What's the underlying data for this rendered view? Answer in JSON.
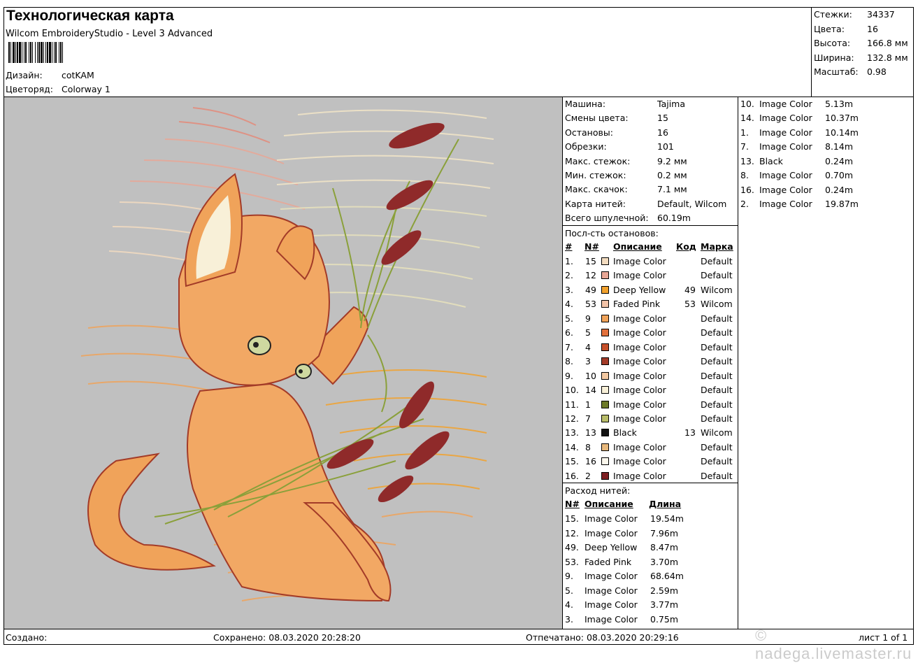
{
  "header": {
    "title": "Технологическая карта",
    "software": "Wilcom EmbroideryStudio - Level 3 Advanced",
    "design_label": "Дизайн:",
    "design_value": "cotKAM",
    "colorway_label": "Цветоряд:",
    "colorway_value": "Colorway 1"
  },
  "summary": [
    {
      "label": "Стежки:",
      "value": "34337"
    },
    {
      "label": "Цвета:",
      "value": "16"
    },
    {
      "label": "Высота:",
      "value": "166.8 мм"
    },
    {
      "label": "Ширина:",
      "value": "132.8 мм"
    },
    {
      "label": "Масштаб:",
      "value": "0.98"
    }
  ],
  "machine": [
    {
      "label": "Машина:",
      "value": "Tajima"
    },
    {
      "label": "Смены цвета:",
      "value": "15"
    },
    {
      "label": "Остановы:",
      "value": "16"
    },
    {
      "label": "Обрезки:",
      "value": "101"
    },
    {
      "label": "Макс. стежок:",
      "value": "9.2 мм"
    },
    {
      "label": "Мин. стежок:",
      "value": "0.2 мм"
    },
    {
      "label": "Макс. скачок:",
      "value": "7.1 мм"
    },
    {
      "label": "Карта нитей:",
      "value": "Default, Wilcom"
    },
    {
      "label": "Всего шпулечной:",
      "value": "60.19m"
    }
  ],
  "stops": {
    "title": "Посл-сть остановов:",
    "headers": [
      "#",
      "N#",
      "Описание",
      "Код",
      "Марка"
    ],
    "rows": [
      {
        "idx": "1.",
        "n": "15",
        "color": "#f3dcc0",
        "desc": "Image Color",
        "code": "",
        "brand": "Default"
      },
      {
        "idx": "2.",
        "n": "12",
        "color": "#e9a796",
        "desc": "Image Color",
        "code": "",
        "brand": "Default"
      },
      {
        "idx": "3.",
        "n": "49",
        "color": "#f2a22e",
        "desc": "Deep Yellow",
        "code": "49",
        "brand": "Wilcom"
      },
      {
        "idx": "4.",
        "n": "53",
        "color": "#f2c3a8",
        "desc": "Faded Pink",
        "code": "53",
        "brand": "Wilcom"
      },
      {
        "idx": "5.",
        "n": "9",
        "color": "#f0a35a",
        "desc": "Image Color",
        "code": "",
        "brand": "Default"
      },
      {
        "idx": "6.",
        "n": "5",
        "color": "#e2713d",
        "desc": "Image Color",
        "code": "",
        "brand": "Default"
      },
      {
        "idx": "7.",
        "n": "4",
        "color": "#c6502b",
        "desc": "Image Color",
        "code": "",
        "brand": "Default"
      },
      {
        "idx": "8.",
        "n": "3",
        "color": "#a33b28",
        "desc": "Image Color",
        "code": "",
        "brand": "Default"
      },
      {
        "idx": "9.",
        "n": "10",
        "color": "#f4c9a2",
        "desc": "Image Color",
        "code": "",
        "brand": "Default"
      },
      {
        "idx": "10.",
        "n": "14",
        "color": "#f8f0d8",
        "desc": "Image Color",
        "code": "",
        "brand": "Default"
      },
      {
        "idx": "11.",
        "n": "1",
        "color": "#6d7a2a",
        "desc": "Image Color",
        "code": "",
        "brand": "Default"
      },
      {
        "idx": "12.",
        "n": "7",
        "color": "#b9bd6a",
        "desc": "Image Color",
        "code": "",
        "brand": "Default"
      },
      {
        "idx": "13.",
        "n": "13",
        "color": "#111111",
        "desc": "Black",
        "code": "13",
        "brand": "Wilcom"
      },
      {
        "idx": "14.",
        "n": "8",
        "color": "#e7b87c",
        "desc": "Image Color",
        "code": "",
        "brand": "Default"
      },
      {
        "idx": "15.",
        "n": "16",
        "color": "#fbf7ec",
        "desc": "Image Color",
        "code": "",
        "brand": "Default"
      },
      {
        "idx": "16.",
        "n": "2",
        "color": "#7d1f22",
        "desc": "Image Color",
        "code": "",
        "brand": "Default"
      }
    ]
  },
  "usage": {
    "title": "Расход нитей:",
    "headers": [
      "N#",
      "Описание",
      "Длина"
    ],
    "rows": [
      {
        "n": "15.",
        "desc": "Image Color",
        "len": "19.54m"
      },
      {
        "n": "12.",
        "desc": "Image Color",
        "len": "7.96m"
      },
      {
        "n": "49.",
        "desc": "Deep Yellow",
        "len": "8.47m"
      },
      {
        "n": "53.",
        "desc": "Faded Pink",
        "len": "3.70m"
      },
      {
        "n": "9.",
        "desc": "Image Color",
        "len": "68.64m"
      },
      {
        "n": "5.",
        "desc": "Image Color",
        "len": "2.59m"
      },
      {
        "n": "4.",
        "desc": "Image Color",
        "len": "3.77m"
      },
      {
        "n": "3.",
        "desc": "Image Color",
        "len": "0.75m"
      }
    ],
    "continued": [
      {
        "n": "10.",
        "desc": "Image Color",
        "len": "5.13m"
      },
      {
        "n": "14.",
        "desc": "Image Color",
        "len": "10.37m"
      },
      {
        "n": "1.",
        "desc": "Image Color",
        "len": "10.14m"
      },
      {
        "n": "7.",
        "desc": "Image Color",
        "len": "8.14m"
      },
      {
        "n": "13.",
        "desc": "Black",
        "len": "0.24m"
      },
      {
        "n": "8.",
        "desc": "Image Color",
        "len": "0.70m"
      },
      {
        "n": "16.",
        "desc": "Image Color",
        "len": "0.24m"
      },
      {
        "n": "2.",
        "desc": "Image Color",
        "len": "19.87m"
      }
    ]
  },
  "footer": {
    "created_label": "Создано:",
    "saved": "Сохранено: 08.03.2020 20:28:20",
    "printed": "Отпечатано: 08.03.2020 20:29:16",
    "page": "лист 1 of 1"
  },
  "watermark": "© nadega.livemaster.ru"
}
